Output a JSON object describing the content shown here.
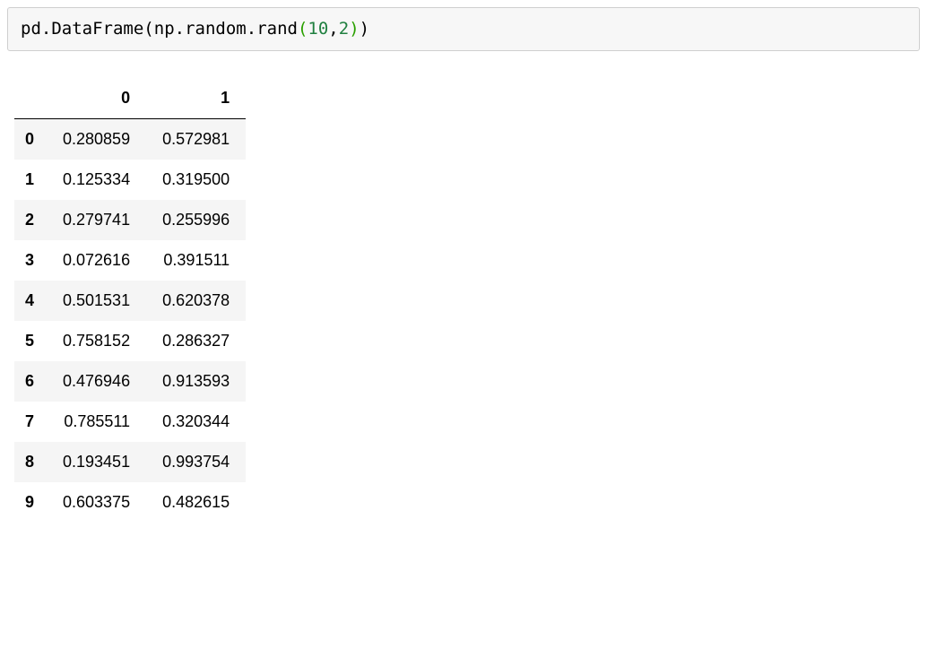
{
  "code": {
    "seg1": "pd",
    "dot1": ".",
    "seg2": "DataFrame",
    "paren_open1": "(",
    "seg3": "np",
    "dot2": ".",
    "seg4": "random",
    "dot3": ".",
    "seg5": "rand",
    "paren_open2": "(",
    "num1": "10",
    "comma": ",",
    "num2": "2",
    "paren_close2": ")",
    "paren_close1": ")"
  },
  "chart_data": {
    "type": "table",
    "columns": [
      "0",
      "1"
    ],
    "index": [
      "0",
      "1",
      "2",
      "3",
      "4",
      "5",
      "6",
      "7",
      "8",
      "9"
    ],
    "values": [
      [
        0.280859,
        0.572981
      ],
      [
        0.125334,
        0.3195
      ],
      [
        0.279741,
        0.255996
      ],
      [
        0.072616,
        0.391511
      ],
      [
        0.501531,
        0.620378
      ],
      [
        0.758152,
        0.286327
      ],
      [
        0.476946,
        0.913593
      ],
      [
        0.785511,
        0.320344
      ],
      [
        0.193451,
        0.993754
      ],
      [
        0.603375,
        0.482615
      ]
    ]
  },
  "table": {
    "col0_header": "0",
    "col1_header": "1",
    "rows": {
      "r0": {
        "idx": "0",
        "c0": "0.280859",
        "c1": "0.572981"
      },
      "r1": {
        "idx": "1",
        "c0": "0.125334",
        "c1": "0.319500"
      },
      "r2": {
        "idx": "2",
        "c0": "0.279741",
        "c1": "0.255996"
      },
      "r3": {
        "idx": "3",
        "c0": "0.072616",
        "c1": "0.391511"
      },
      "r4": {
        "idx": "4",
        "c0": "0.501531",
        "c1": "0.620378"
      },
      "r5": {
        "idx": "5",
        "c0": "0.758152",
        "c1": "0.286327"
      },
      "r6": {
        "idx": "6",
        "c0": "0.476946",
        "c1": "0.913593"
      },
      "r7": {
        "idx": "7",
        "c0": "0.785511",
        "c1": "0.320344"
      },
      "r8": {
        "idx": "8",
        "c0": "0.193451",
        "c1": "0.993754"
      },
      "r9": {
        "idx": "9",
        "c0": "0.603375",
        "c1": "0.482615"
      }
    }
  }
}
